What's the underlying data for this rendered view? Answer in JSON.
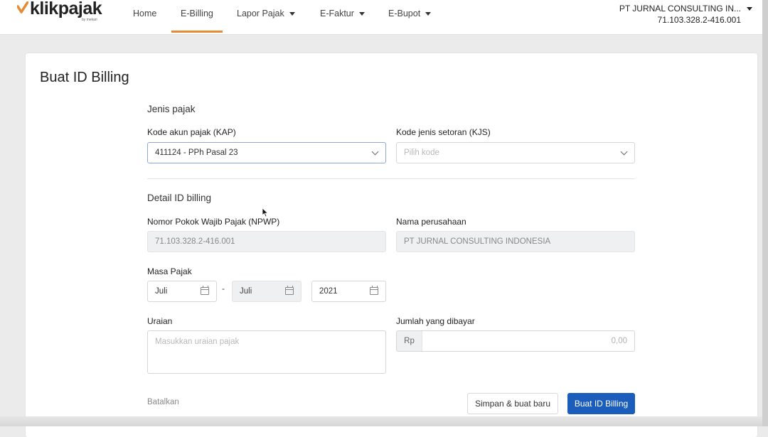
{
  "brand": {
    "name": "klikpajak",
    "sub": "by mekari",
    "accent": "#e48b33"
  },
  "nav": {
    "items": [
      {
        "label": "Home",
        "has_dropdown": false,
        "active": false
      },
      {
        "label": "E-Billing",
        "has_dropdown": false,
        "active": true
      },
      {
        "label": "Lapor Pajak",
        "has_dropdown": true,
        "active": false
      },
      {
        "label": "E-Faktur",
        "has_dropdown": true,
        "active": false
      },
      {
        "label": "E-Bupot",
        "has_dropdown": true,
        "active": false
      }
    ]
  },
  "account": {
    "company": "PT JURNAL CONSULTING IN...",
    "npwp": "71.103.328.2-416.001"
  },
  "page": {
    "title": "Buat ID Billing"
  },
  "jenis_pajak": {
    "title": "Jenis pajak",
    "kap_label": "Kode akun pajak (KAP)",
    "kap_value": "411124 - PPh Pasal 23",
    "kjs_label": "Kode jenis setoran (KJS)",
    "kjs_placeholder": "Pilih kode"
  },
  "detail": {
    "title": "Detail ID billing",
    "npwp_label": "Nomor Pokok Wajib Pajak (NPWP)",
    "npwp_value": "71.103.328.2-416.001",
    "company_label": "Nama perusahaan",
    "company_value": "PT JURNAL CONSULTING INDONESIA",
    "masa_label": "Masa Pajak",
    "masa_start": "Juli",
    "masa_sep": "-",
    "masa_end": "Juli",
    "tahun": "2021",
    "uraian_label": "Uraian",
    "uraian_placeholder": "Masukkan uraian pajak",
    "jumlah_label": "Jumlah yang dibayar",
    "currency": "Rp",
    "jumlah_placeholder": "0,00"
  },
  "actions": {
    "cancel": "Batalkan",
    "save_new": "Simpan & buat baru",
    "submit": "Buat ID Billing"
  },
  "icons": [
    "check-logo-icon",
    "chevron-down-icon",
    "calendar-icon",
    "caret-down-icon",
    "mouse-cursor-icon"
  ],
  "colors": {
    "primary_button": "#1a5dbb",
    "active_tab": "#e48b33",
    "disabled_field": "#eef0f2"
  }
}
